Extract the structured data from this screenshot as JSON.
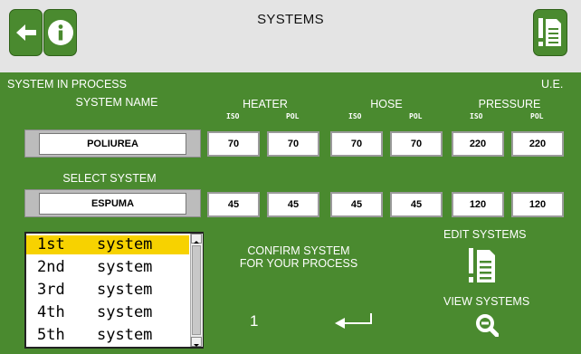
{
  "header": {
    "title": "SYSTEMS",
    "back_icon": "arrow-left-icon",
    "info_icon": "info-icon",
    "doc_icon": "document-icon"
  },
  "labels": {
    "system_in_process": "SYSTEM IN PROCESS",
    "system_name": "SYSTEM NAME",
    "heater": "HEATER",
    "hose": "HOSE",
    "pressure": "PRESSURE",
    "units": "U.E.",
    "iso": "ISO",
    "pol": "POL",
    "select_system": "SELECT SYSTEM"
  },
  "current_system": {
    "name": "POLIUREA",
    "heater_iso": "70",
    "heater_pol": "70",
    "hose_iso": "70",
    "hose_pol": "70",
    "pressure_iso": "220",
    "pressure_pol": "220"
  },
  "selected_system": {
    "name": "ESPUMA",
    "heater_iso": "45",
    "heater_pol": "45",
    "hose_iso": "45",
    "hose_pol": "45",
    "pressure_iso": "120",
    "pressure_pol": "120"
  },
  "system_list": [
    {
      "ordinal": "1st",
      "name": "system",
      "selected": true
    },
    {
      "ordinal": "2nd",
      "name": "system",
      "selected": false
    },
    {
      "ordinal": "3rd",
      "name": "system",
      "selected": false
    },
    {
      "ordinal": "4th",
      "name": "system",
      "selected": false
    },
    {
      "ordinal": "5th",
      "name": "system",
      "selected": false
    }
  ],
  "confirm": {
    "line1": "CONFIRM SYSTEM",
    "line2": "FOR YOUR PROCESS",
    "number": "1",
    "enter_icon": "enter-arrow-icon"
  },
  "edit_systems": {
    "label": "EDIT SYSTEMS",
    "icon": "document-icon"
  },
  "view_systems": {
    "label": "VIEW SYSTEMS",
    "icon": "magnifier-icon"
  },
  "colors": {
    "background": "#4a8a2f",
    "header": "#e4e4e4",
    "selection": "#f7d200"
  }
}
